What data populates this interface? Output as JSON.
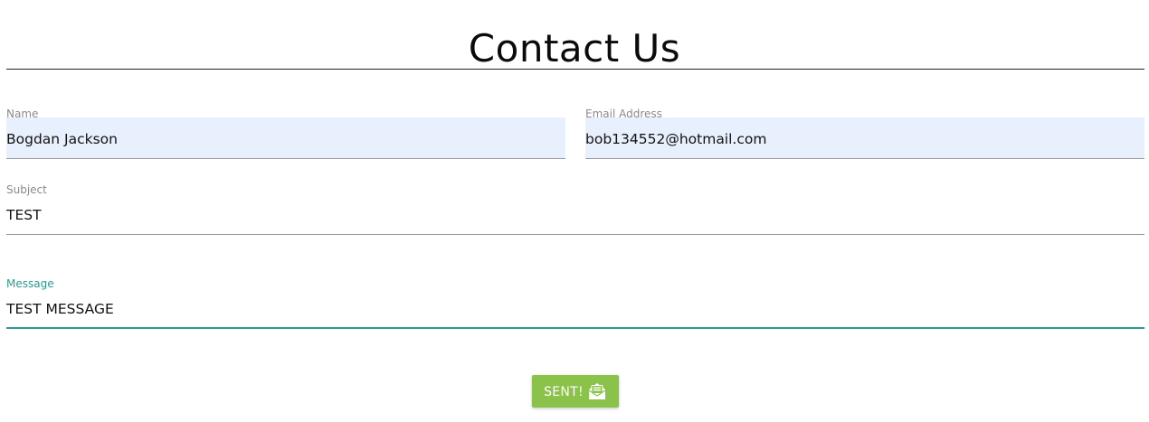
{
  "page": {
    "title": "Contact Us"
  },
  "form": {
    "name": {
      "label": "Name",
      "value": "Bogdan Jackson"
    },
    "email": {
      "label": "Email Address",
      "value": "bob134552@hotmail.com"
    },
    "subject": {
      "label": "Subject",
      "value": "TEST"
    },
    "message": {
      "label": "Message",
      "value": "TEST MESSAGE"
    },
    "submit": {
      "label": "SENT!",
      "icon": "envelope-open-icon"
    }
  },
  "colors": {
    "accent": "#2a9d8f",
    "button": "#8bc34a",
    "autofill": "#e8f0fe"
  }
}
